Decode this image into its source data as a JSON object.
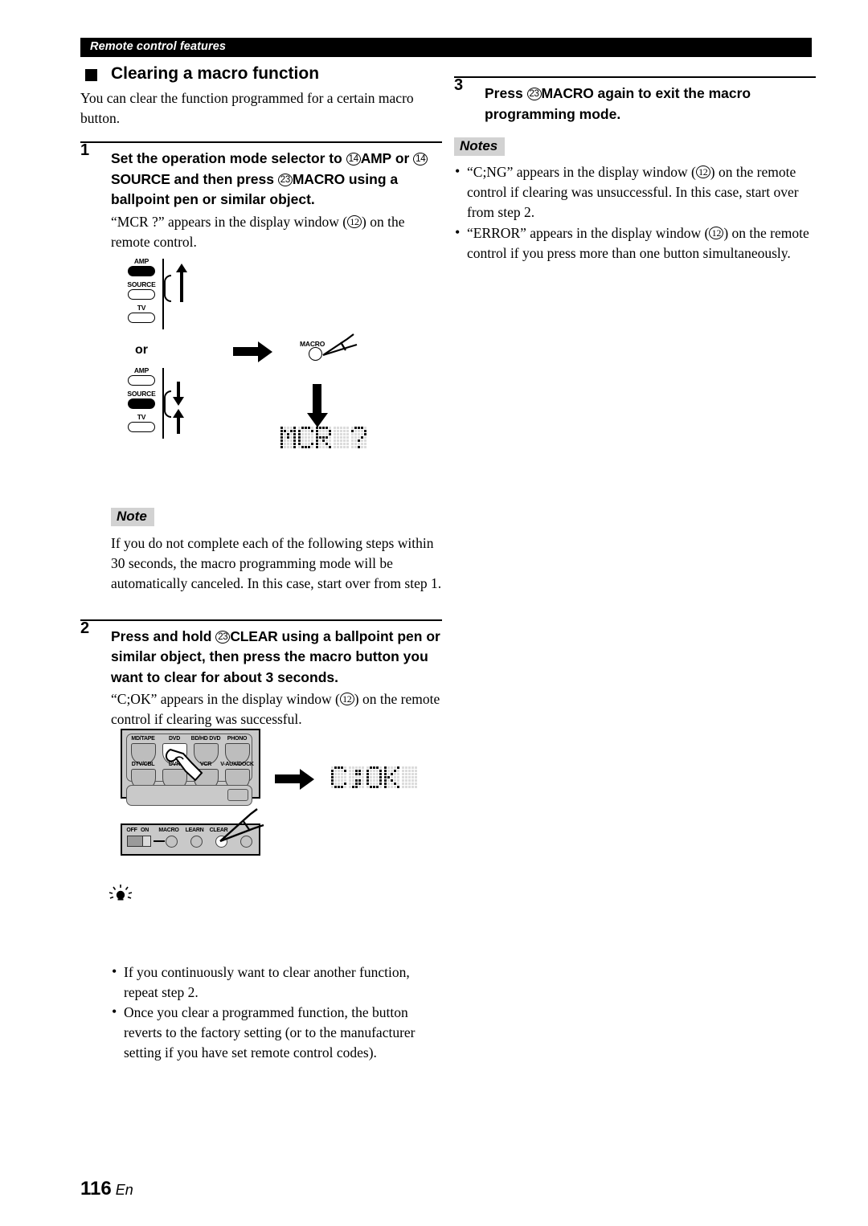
{
  "header": {
    "running_title": "Remote control features"
  },
  "left": {
    "section_heading": "Clearing a macro function",
    "intro": "You can clear the function programmed for a certain macro button.",
    "step1": {
      "number": "1",
      "title_parts": {
        "t1": "Set the operation mode selector to ",
        "ref14a": "14",
        "amp": "AMP",
        "t2": " or ",
        "ref14b": "14",
        "source": "SOURCE",
        "t3": " and then press ",
        "ref23": "23",
        "macro": "MACRO",
        "t4": " using a ballpoint pen or similar object."
      },
      "desc_parts": {
        "d1": "“MCR ?” appears in the display window (",
        "ref12": "12",
        "d2": ") on the remote control."
      }
    },
    "note": {
      "tag": "Note",
      "text": "If you do not complete each of the following steps within 30 seconds, the macro programming mode will be automatically canceled. In this case, start over from step 1."
    },
    "step2": {
      "number": "2",
      "title_parts": {
        "t1": "Press and hold ",
        "ref23": "23",
        "clear": "CLEAR",
        "t2": " using a ballpoint pen or similar object, then press the macro button you want to clear for about 3 seconds."
      },
      "desc_parts": {
        "d1": "“C;OK” appears in the display window (",
        "ref12": "12",
        "d2": ") on the remote control if clearing was successful."
      }
    },
    "tips": {
      "icon": "lightbulb-tip-icon",
      "items": [
        "If you continuously want to clear another function, repeat step 2.",
        "Once you clear a programmed function, the button reverts to the factory setting (or to the manufacturer setting if you have set remote control codes)."
      ]
    }
  },
  "right": {
    "step3": {
      "number": "3",
      "title_parts": {
        "t1": "Press ",
        "ref23": "23",
        "macro": "MACRO",
        "t2": " again to exit the macro programming mode."
      }
    },
    "notes": {
      "tag": "Notes",
      "items": [
        {
          "p1": "“C;NG” appears in the display window (",
          "ref": "12",
          "p2": ") on the remote control if clearing was unsuccessful. In this case, start over from step 2."
        },
        {
          "p1": "“ERROR” appears in the display window (",
          "ref": "12",
          "p2": ") on the remote control if you press more than one button simultaneously."
        }
      ]
    }
  },
  "figure1": {
    "selector_a": {
      "labels": [
        "AMP",
        "SOURCE",
        "TV"
      ],
      "selected": "AMP"
    },
    "or_label": "or",
    "selector_b": {
      "labels": [
        "AMP",
        "SOURCE",
        "TV"
      ],
      "selected": "SOURCE"
    },
    "macro_button_label": "MACRO",
    "display_text": "MCR ?"
  },
  "figure2": {
    "input_buttons_row1": [
      "MD/TAPE",
      "DVD",
      "BD/HD DVD",
      "PHONO"
    ],
    "input_buttons_row2": [
      "DTV/CBL",
      "DVR",
      "VCR",
      "V-AUX/DOCK"
    ],
    "highlighted_button": "DVD",
    "switch_labels": [
      "OFF",
      "ON",
      "MACRO",
      "LEARN",
      "CLEAR"
    ],
    "highlighted_switch": "CLEAR",
    "display_text": "C;OK"
  },
  "footer": {
    "page_number": "116",
    "language": "En"
  },
  "colors": {
    "header_bar": "#000000",
    "note_tag_bg": "#d2d2d2",
    "panel_gray": "#c9c9c9",
    "dot_off": "#dcdcdc",
    "dot_on": "#111111"
  }
}
